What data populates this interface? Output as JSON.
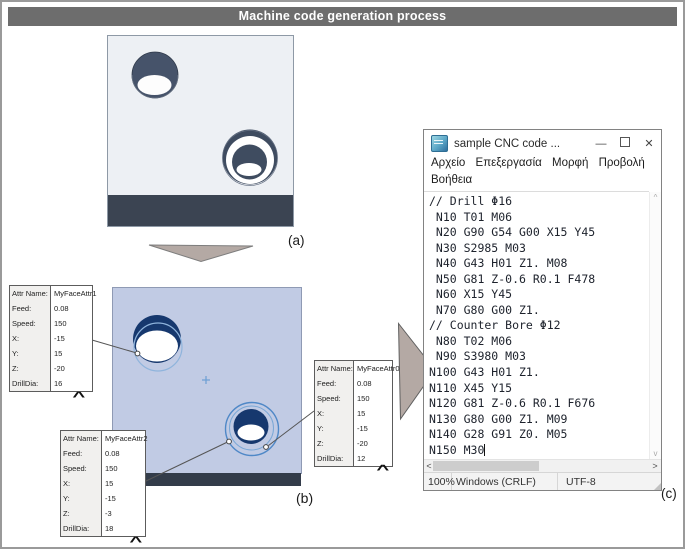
{
  "figure": {
    "title": "Machine code generation process",
    "labels": {
      "a": "(a)",
      "b": "(b)",
      "c": "(c)"
    }
  },
  "attr_tables": [
    {
      "name": "MyFaceAttr0",
      "rows": [
        [
          "Attr Name:",
          "MyFaceAttr0"
        ],
        [
          "Feed:",
          "0.08"
        ],
        [
          "Speed:",
          "150"
        ],
        [
          "X:",
          "15"
        ],
        [
          "Y:",
          "-15"
        ],
        [
          "Z:",
          "-20"
        ],
        [
          "DrillDia:",
          "12"
        ]
      ]
    },
    {
      "name": "MyFaceAttr1",
      "rows": [
        [
          "Attr Name:",
          "MyFaceAttr1"
        ],
        [
          "Feed:",
          "0.08"
        ],
        [
          "Speed:",
          "150"
        ],
        [
          "X:",
          "-15"
        ],
        [
          "Y:",
          "15"
        ],
        [
          "Z:",
          "-20"
        ],
        [
          "DrillDia:",
          "16"
        ]
      ]
    },
    {
      "name": "MyFaceAttr2",
      "rows": [
        [
          "Attr Name:",
          "MyFaceAttr2"
        ],
        [
          "Feed:",
          "0.08"
        ],
        [
          "Speed:",
          "150"
        ],
        [
          "X:",
          "15"
        ],
        [
          "Y:",
          "-15"
        ],
        [
          "Z:",
          "-3"
        ],
        [
          "DrillDia:",
          "18"
        ]
      ]
    }
  ],
  "collapse_caret": "^",
  "notepad": {
    "window_title": "sample CNC code ...",
    "controls": {
      "minimize": "—",
      "close": "✕"
    },
    "menu_items": [
      "Αρχείο",
      "Επεξεργασία",
      "Μορφή",
      "Προβολή",
      "Βοήθεια"
    ],
    "code_lines": [
      "// Drill Φ16",
      " N10 T01 M06",
      " N20 G90 G54 G00 X15 Y45",
      " N30 S2985 M03",
      " N40 G43 H01 Z1. M08",
      " N50 G81 Z-0.6 R0.1 F478",
      " N60 X15 Y45",
      " N70 G80 G00 Z1.",
      "// Counter Bore Φ12",
      " N80 T02 M06",
      " N90 S3980 M03",
      "N100 G43 H01 Z1.",
      "N110 X45 Y15",
      "N120 G81 Z-0.6 R0.1 F676",
      "N130 G80 G00 Z1. M09",
      "N140 G28 G91 Z0. M05",
      "N150 M30"
    ],
    "scroll_icons": {
      "up": "^",
      "down": "v",
      "left": "<",
      "right": ">"
    },
    "status": {
      "zoom": "100%",
      "line_ending": "Windows (CRLF)",
      "encoding": "UTF-8"
    }
  },
  "colors": {
    "title_bar": "#6d6d6d",
    "block_a_fill": "#edf0f4",
    "block_dark_band": "#3b4452",
    "block_b_fill": "#c1cbe4",
    "hole_navy": "#16386e",
    "selection_blue": "#4f88c7",
    "arrow_fill": "#b4a9a4"
  }
}
